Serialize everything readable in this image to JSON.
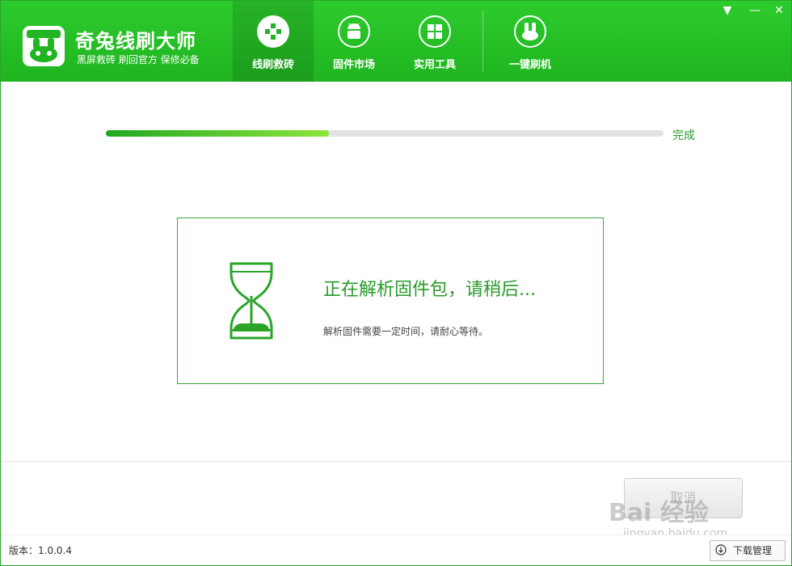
{
  "header": {
    "app_title": "奇兔线刷大师",
    "app_subtitle": "黑屏救砖 刷回官方 保修必备",
    "nav": [
      {
        "label": "线刷救砖",
        "icon": "cross-plus-icon",
        "active": true
      },
      {
        "label": "固件市场",
        "icon": "android-icon",
        "active": false
      },
      {
        "label": "实用工具",
        "icon": "grid-icon",
        "active": false
      },
      {
        "label": "一键刷机",
        "icon": "rabbit-icon",
        "active": false
      }
    ],
    "window_controls": [
      "▼",
      "—",
      "✕"
    ]
  },
  "progress": {
    "percent": 40,
    "label": "完成"
  },
  "message": {
    "title": "正在解析固件包，请稍后...",
    "subtitle": "解析固件需要一定时间，请耐心等待。"
  },
  "footer": {
    "cancel_label": "取消",
    "version": "版本：1.0.0.4",
    "download_manager": "下载管理"
  },
  "watermark": {
    "main": "Bai 经验",
    "sub": "jingyan.baidu.com"
  },
  "colors": {
    "brand_green": "#22b422",
    "accent_text": "#2a9a2a"
  }
}
